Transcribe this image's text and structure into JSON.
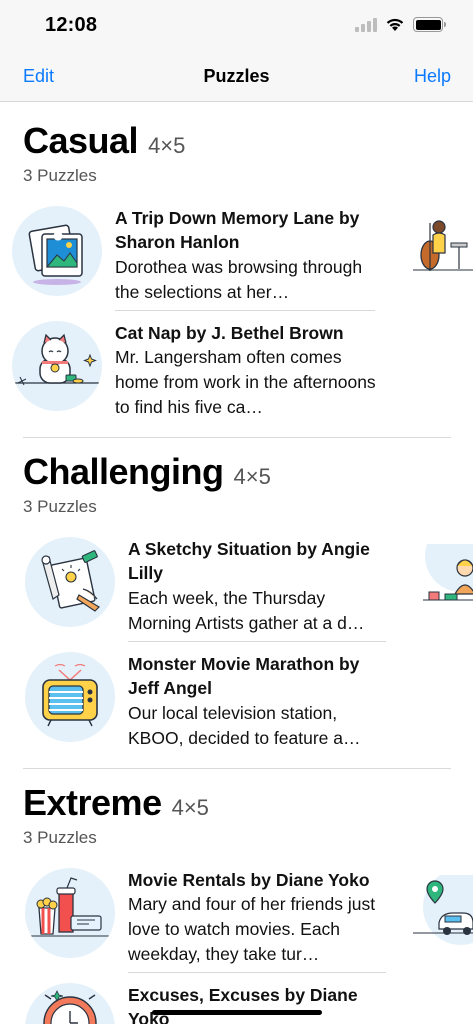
{
  "status": {
    "time": "12:08"
  },
  "nav": {
    "edit": "Edit",
    "title": "Puzzles",
    "help": "Help"
  },
  "sections": [
    {
      "title": "Casual",
      "size": "4×5",
      "count": "3 Puzzles",
      "puzzles": [
        {
          "title": "A Trip Down Memory Lane by Sharon Hanlon",
          "desc": "Dorothea was browsing through the selections at her…",
          "icon": "photo-frame-icon"
        },
        {
          "title": "Cat Nap by J. Bethel Brown",
          "desc": "Mr. Langersham often comes home from work in the afternoons to find his five ca…",
          "icon": "lucky-cat-icon"
        }
      ],
      "peek_icon": "cello-player-icon"
    },
    {
      "title": "Challenging",
      "size": "4×5",
      "count": "3 Puzzles",
      "puzzles": [
        {
          "title": "A Sketchy Situation by Angie Lilly",
          "desc": "Each week, the Thursday Morning Artists gather at a d…",
          "icon": "sketch-tools-icon"
        },
        {
          "title": "Monster Movie Marathon by Jeff Angel",
          "desc": "Our local television station, KBOO, decided to feature a…",
          "icon": "retro-tv-icon"
        }
      ],
      "peek_icon": "person-at-desk-icon"
    },
    {
      "title": "Extreme",
      "size": "4×5",
      "count": "3 Puzzles",
      "puzzles": [
        {
          "title": "Movie Rentals by Diane Yoko",
          "desc": "Mary and four of her friends just love to watch movies. Each weekday, they take tur…",
          "icon": "popcorn-tickets-icon"
        },
        {
          "title": "Excuses, Excuses by Diane Yoko",
          "desc": "",
          "icon": "alarm-clock-icon"
        }
      ],
      "peek_icon": "map-pin-car-icon"
    }
  ]
}
